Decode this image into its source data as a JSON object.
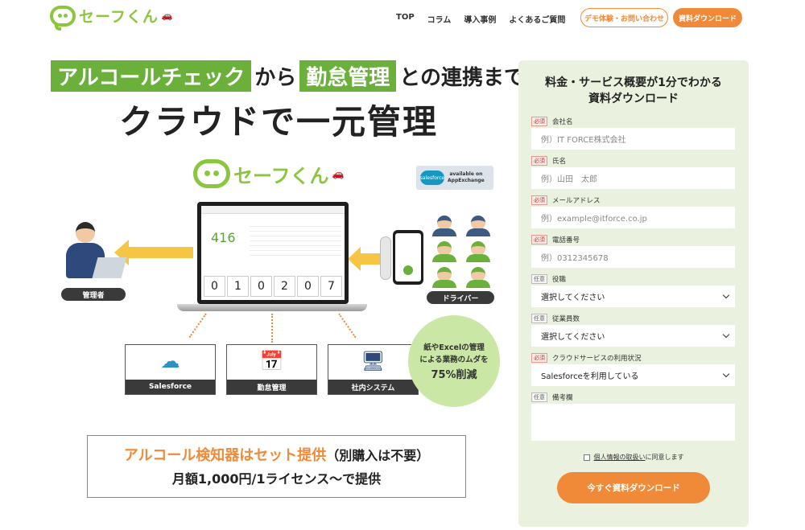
{
  "header": {
    "logo_text": "セーフくん",
    "nav": [
      "TOP",
      "コラム",
      "導入事例",
      "よくあるご質問"
    ],
    "demo_button": "デモ体験・お問い合わせ",
    "download_button": "資料ダウンロード"
  },
  "hero": {
    "tag1": "アルコールチェック",
    "mid1": "から",
    "tag2": "勤怠管理",
    "mid2": "との連携まで",
    "line2": "クラウドで一元管理"
  },
  "illustration": {
    "logo_text": "セーフくん",
    "salesforce_badge": {
      "logo": "salesforce",
      "text1": "available on",
      "text2": "AppExchange"
    },
    "screen_number": "416",
    "digits": [
      "0",
      "1",
      "0",
      "2",
      "0",
      "7"
    ],
    "admin_label": "管理者",
    "driver_label": "ドライバー",
    "boxes": [
      "Salesforce",
      "勤怠管理",
      "社内システム"
    ],
    "circle": {
      "line1": "紙やExcelの管理",
      "line2": "による業務のムダを",
      "pct": "75%削減"
    }
  },
  "offer": {
    "line1_orange": "アルコール検知器はセット提供",
    "line1_note": "（別購入は不要）",
    "line2": "月額1,000円/1ライセンス〜で提供"
  },
  "form": {
    "title_line1": "料金・サービス概要が1分でわかる",
    "title_line2": "資料ダウンロード",
    "required_tag": "必須",
    "optional_tag": "任意",
    "company_label": "会社名",
    "company_placeholder": "例）IT FORCE株式会社",
    "name_label": "氏名",
    "name_placeholder": "例）山田　太郎",
    "email_label": "メールアドレス",
    "email_placeholder": "例）example@itforce.co.jp",
    "phone_label": "電話番号",
    "phone_placeholder": "例）0312345678",
    "role_label": "役職",
    "role_value": "選択してください",
    "employees_label": "従業員数",
    "employees_value": "選択してください",
    "cloud_label": "クラウドサービスの利用状況",
    "cloud_value": "Salesforceを利用している",
    "notes_label": "備考欄",
    "privacy_link": "個人情報の取扱い",
    "privacy_suffix": "に同意します",
    "submit": "今すぐ資料ダウンロード"
  }
}
